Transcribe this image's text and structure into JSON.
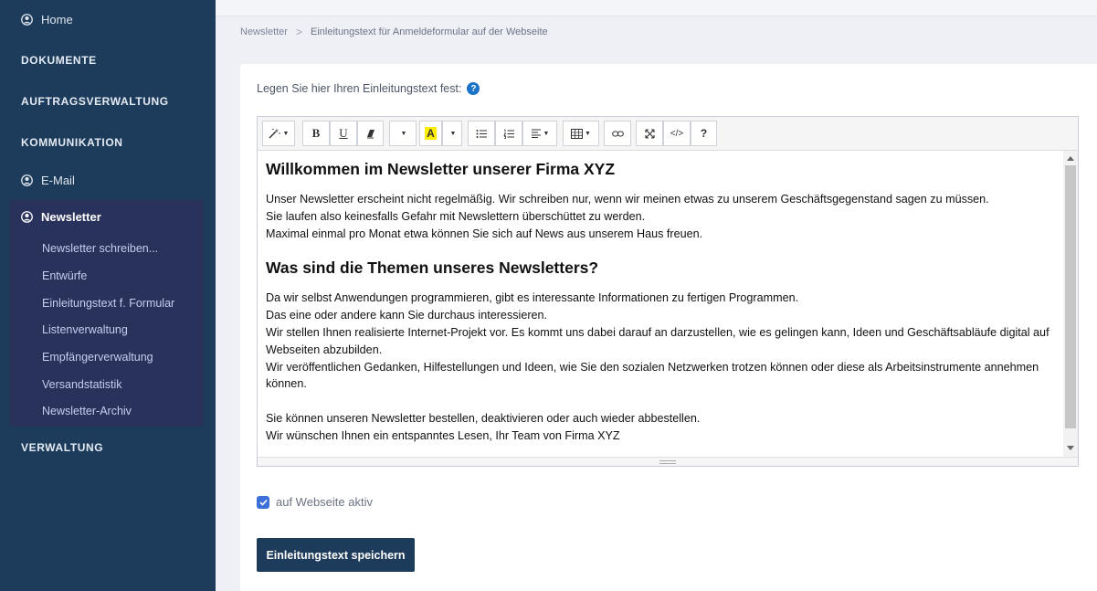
{
  "sidebar": {
    "home": "Home",
    "sections": {
      "dokumente": "DOKUMENTE",
      "auftragsverwaltung": "AUFTRAGSVERWALTUNG",
      "kommunikation": "KOMMUNIKATION",
      "verwaltung": "VERWALTUNG"
    },
    "email": "E-Mail",
    "newsletter": {
      "label": "Newsletter",
      "items": [
        "Newsletter schreiben...",
        "Entwürfe",
        "Einleitungstext f. Formular",
        "Listenverwaltung",
        "Empfängerverwaltung",
        "Versandstatistik",
        "Newsletter-Archiv"
      ]
    }
  },
  "breadcrumb": {
    "parent": "Newsletter",
    "separator": ">",
    "current": "Einleitungstext für Anmeldeformular auf der Webseite"
  },
  "form": {
    "label": "Legen Sie hier Ihren Einleitungstext fest:",
    "help": "?",
    "checkbox_label": "auf Webseite aktiv",
    "checkbox_checked": true,
    "save_label": "Einleitungstext speichern"
  },
  "editor": {
    "toolbar": {
      "magic": "magic-wand-icon",
      "bold": "B",
      "underline": "U",
      "eraser": "eraser-icon",
      "fontsize": "font-size-dropdown",
      "color": "A",
      "ul": "unordered-list-icon",
      "ol": "ordered-list-icon",
      "align": "align-icon",
      "table": "table-icon",
      "link": "link-icon",
      "fullscreen": "fullscreen-icon",
      "code": "</>",
      "help": "?"
    },
    "content": {
      "heading1": "Willkommen im Newsletter unserer Firma XYZ",
      "para1_lines": [
        "Unser Newsletter erscheint nicht regelmäßig. Wir schreiben nur, wenn wir meinen etwas zu unserem Geschäftsgegenstand sagen zu müssen.",
        "Sie laufen also keinesfalls Gefahr mit Newslettern überschüttet zu werden.",
        "Maximal einmal pro Monat etwa können Sie sich auf News aus unserem Haus freuen."
      ],
      "heading2": "Was sind die Themen unseres Newsletters?",
      "para2_lines": [
        "Da wir selbst Anwendungen programmieren, gibt es interessante Informationen zu fertigen Programmen.",
        "Das eine oder andere kann Sie durchaus interessieren.",
        "Wir stellen Ihnen realisierte Internet-Projekt vor. Es kommt uns dabei darauf an darzustellen, wie es gelingen kann, Ideen und Geschäftsabläufe digital auf Webseiten abzubilden.",
        "Wir veröffentlichen Gedanken, Hilfestellungen und Ideen, wie Sie den sozialen Netzwerken trotzen können oder diese als Arbeitsinstrumente annehmen können."
      ],
      "para3_lines": [
        "Sie können unseren Newsletter bestellen, deaktivieren oder auch wieder abbestellen.",
        "Wir wünschen Ihnen ein entspanntes Lesen, Ihr Team von Firma XYZ"
      ]
    }
  },
  "colors": {
    "sidebar_bg": "#1d3b5a",
    "sidebar_sub_bg": "#28325a",
    "accent": "#3d6fd8",
    "help_blue": "#1a73c8"
  }
}
